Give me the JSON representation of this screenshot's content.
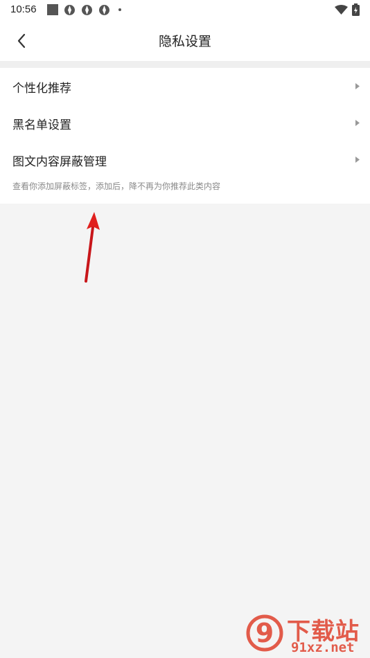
{
  "status_bar": {
    "time": "10:56",
    "icons": [
      "square-notification-icon",
      "aperture-icon",
      "aperture-icon",
      "aperture-icon",
      "more-dot-icon",
      "wifi-icon",
      "battery-icon"
    ]
  },
  "header": {
    "title": "隐私设置",
    "back_icon": "chevron-left-icon"
  },
  "list": {
    "items": [
      {
        "label": "个性化推荐"
      },
      {
        "label": "黑名单设置"
      },
      {
        "label": "图文内容屏蔽管理"
      }
    ],
    "hint": "查看你添加屏蔽标签，添加后，降不再为你推荐此类内容"
  },
  "colors": {
    "background": "#f4f4f4",
    "card": "#ffffff",
    "annotation_arrow": "#e0201e",
    "watermark": "#e25b4a"
  },
  "watermark": {
    "logo_glyph": "9",
    "title": "下载站",
    "domain": "91xz.net"
  }
}
